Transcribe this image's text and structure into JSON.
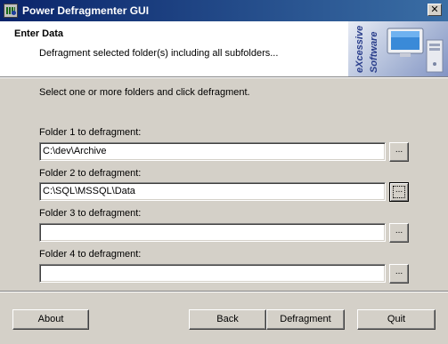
{
  "window": {
    "title": "Power Defragmenter GUI",
    "close_glyph": "✕"
  },
  "header": {
    "title": "Enter Data",
    "subtitle": "Defragment selected folder(s) including all subfolders...",
    "logo_text_line1": "eXcessive",
    "logo_text_line2": "Software"
  },
  "body": {
    "instruction": "Select one or more folders and click defragment.",
    "folders": [
      {
        "label": "Folder 1 to defragment:",
        "value": "C:\\dev\\Archive",
        "browse_label": "..."
      },
      {
        "label": "Folder 2 to defragment:",
        "value": "C:\\SQL\\MSSQL\\Data",
        "browse_label": "..."
      },
      {
        "label": "Folder 3 to defragment:",
        "value": "",
        "browse_label": "..."
      },
      {
        "label": "Folder 4 to defragment:",
        "value": "",
        "browse_label": "..."
      }
    ]
  },
  "footer": {
    "about_label": "About",
    "back_label": "Back",
    "defragment_label": "Defragment",
    "quit_label": "Quit"
  },
  "icons": {
    "app": "defragmenter-app-icon",
    "close": "close-icon",
    "logo": "computer-logo-icon"
  },
  "colors": {
    "titlebar_start": "#0a246a",
    "titlebar_end": "#3a6ea5",
    "face": "#d4d0c8"
  }
}
